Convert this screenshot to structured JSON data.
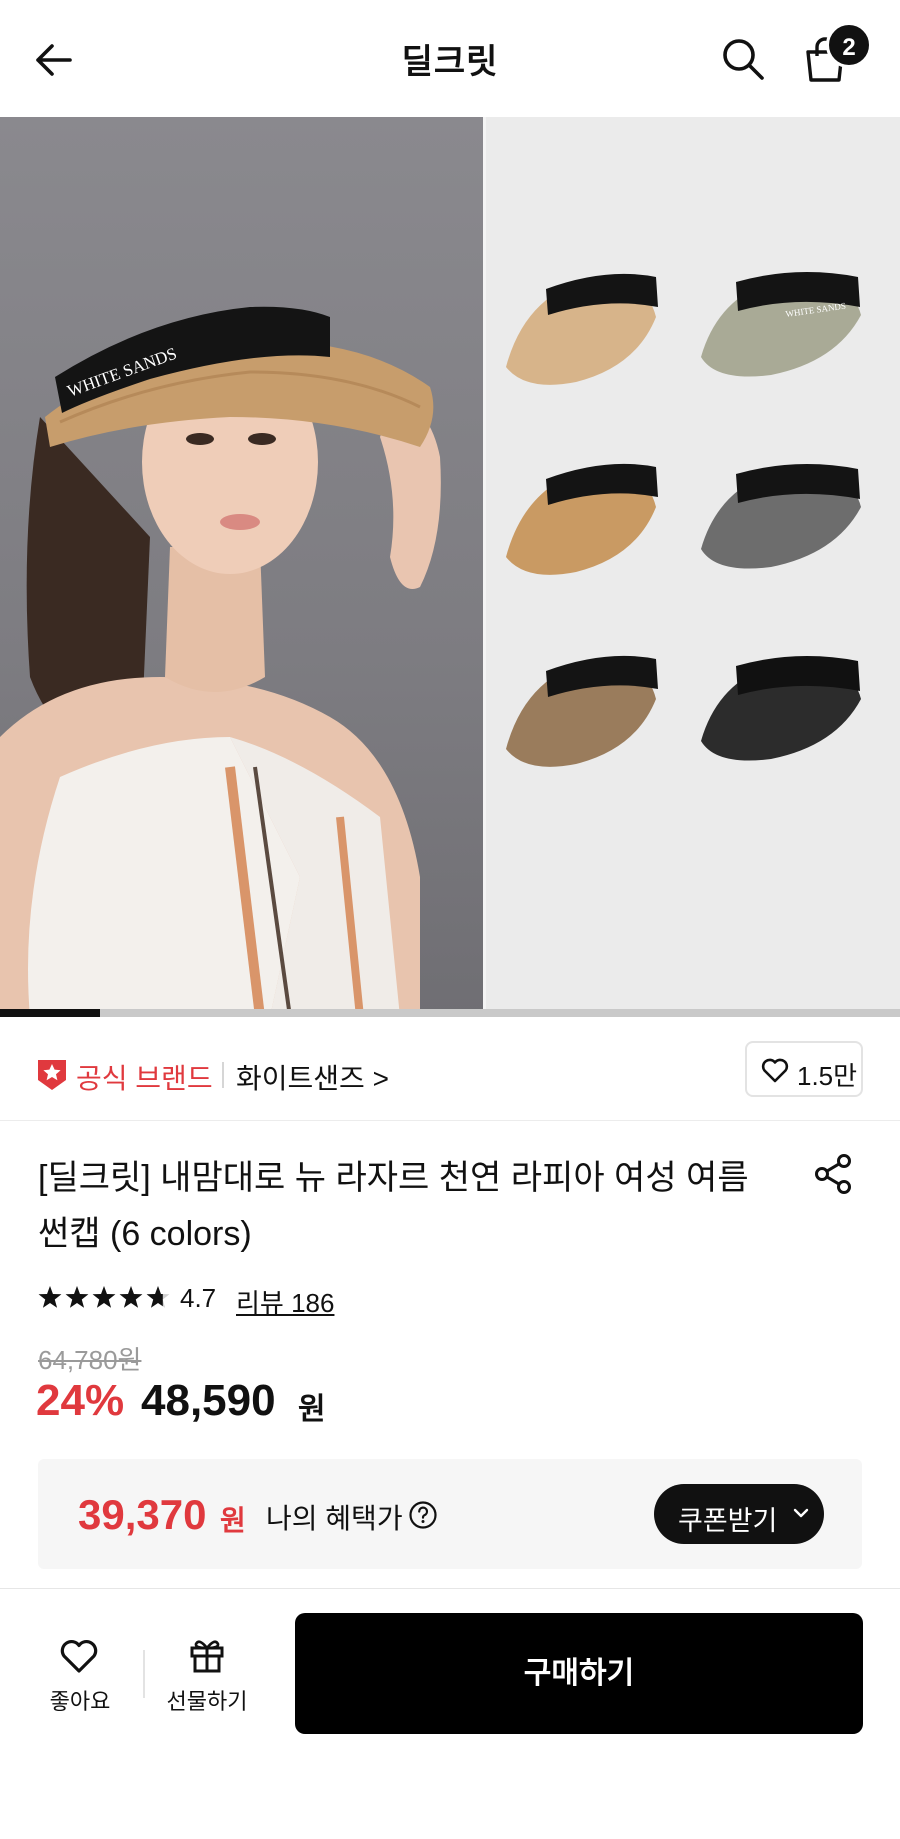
{
  "header": {
    "title": "딜크릿",
    "cart_count": "2",
    "icons": {
      "back": "arrow-left-icon",
      "search": "search-icon",
      "cart": "shopping-bag-icon"
    }
  },
  "hero": {
    "image_count": 9,
    "current_index": 1,
    "photo_text": {
      "visor_band": "WHITE SANDS",
      "product_band": "WHITE SANDS"
    }
  },
  "brand": {
    "official_label": "공식 브랜드",
    "name": "화이트샌즈 >",
    "like_count": "1.5만"
  },
  "product": {
    "title": "[딜크릿] 내맘대로 뉴 라자르 천연 라피아 여성 여름 썬캡 (6 colors)",
    "rating_stars": 4.7,
    "rating": "4.7",
    "review_label": "리뷰 186",
    "original_price": "64,780원",
    "discount_rate": "24%",
    "sale_price": "48,590",
    "sale_unit": "원"
  },
  "benefit": {
    "price": "39,370",
    "unit": "원",
    "label": "나의 혜택가",
    "coupon_label": "쿠폰받기"
  },
  "bottom_bar": {
    "favorite_label": "좋아요",
    "gift_label": "선물하기",
    "buy_label": "구매하기"
  },
  "colors": {
    "accent_red": "#e0393e",
    "black": "#111111",
    "benefit_bg": "#f6f6f6"
  }
}
